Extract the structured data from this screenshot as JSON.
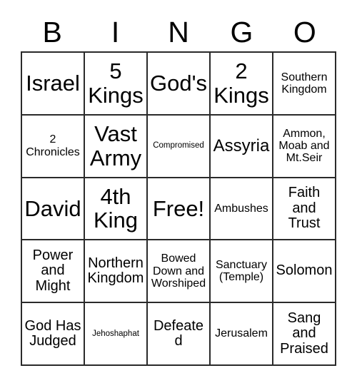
{
  "card": {
    "title_letters": [
      "B",
      "I",
      "N",
      "G",
      "O"
    ],
    "rows": [
      [
        {
          "text": "Israel",
          "size": "fs-xxl"
        },
        {
          "text": "5 Kings",
          "size": "fs-xxl"
        },
        {
          "text": "God's",
          "size": "fs-xxl"
        },
        {
          "text": "2 Kings",
          "size": "fs-xxl"
        },
        {
          "text": "Southern Kingdom",
          "size": "fs-sm"
        }
      ],
      [
        {
          "text": "2 Chronicles",
          "size": "fs-sm"
        },
        {
          "text": "Vast Army",
          "size": "fs-xxl"
        },
        {
          "text": "Compromised",
          "size": "fs-xxs"
        },
        {
          "text": "Assyria",
          "size": "fs-lg"
        },
        {
          "text": "Ammon, Moab and Mt.Seir",
          "size": "fs-sm"
        }
      ],
      [
        {
          "text": "David",
          "size": "fs-xxl"
        },
        {
          "text": "4th King",
          "size": "fs-xxl"
        },
        {
          "text": "Free!",
          "size": "fs-xxl"
        },
        {
          "text": "Ambushes",
          "size": "fs-sm"
        },
        {
          "text": "Faith and Trust",
          "size": "fs-md"
        }
      ],
      [
        {
          "text": "Power and Might",
          "size": "fs-md"
        },
        {
          "text": "Northern Kingdom",
          "size": "fs-md"
        },
        {
          "text": "Bowed Down and Worshiped",
          "size": "fs-sm"
        },
        {
          "text": "Sanctuary (Temple)",
          "size": "fs-sm"
        },
        {
          "text": "Solomon",
          "size": "fs-md"
        }
      ],
      [
        {
          "text": "God Has Judged",
          "size": "fs-md"
        },
        {
          "text": "Jehoshaphat",
          "size": "fs-xxs"
        },
        {
          "text": "Defeated",
          "size": "fs-md"
        },
        {
          "text": "Jerusalem",
          "size": "fs-sm"
        },
        {
          "text": "Sang and Praised",
          "size": "fs-md"
        }
      ]
    ]
  },
  "colors": {
    "border": "#2a2a2a",
    "background": "#ffffff",
    "text": "#000000"
  }
}
